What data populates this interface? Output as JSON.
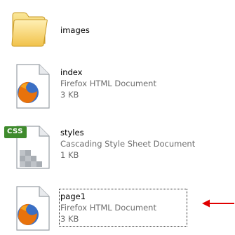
{
  "files": [
    {
      "name": "images",
      "type": "",
      "size": "",
      "icon": "folder-icon"
    },
    {
      "name": "index",
      "type": "Firefox HTML Document",
      "size": "3 KB",
      "icon": "firefox-html-icon"
    },
    {
      "name": "styles",
      "type": "Cascading Style Sheet Document",
      "size": "1 KB",
      "icon": "css-file-icon"
    },
    {
      "name": "page1",
      "type": "Firefox HTML Document",
      "size": "3 KB",
      "icon": "firefox-html-icon",
      "selected": true
    }
  ],
  "css_badge": "CSS",
  "colors": {
    "arrow": "#e00000",
    "secondary_text": "#6d6d6d",
    "folder": "#f3cf5a"
  }
}
